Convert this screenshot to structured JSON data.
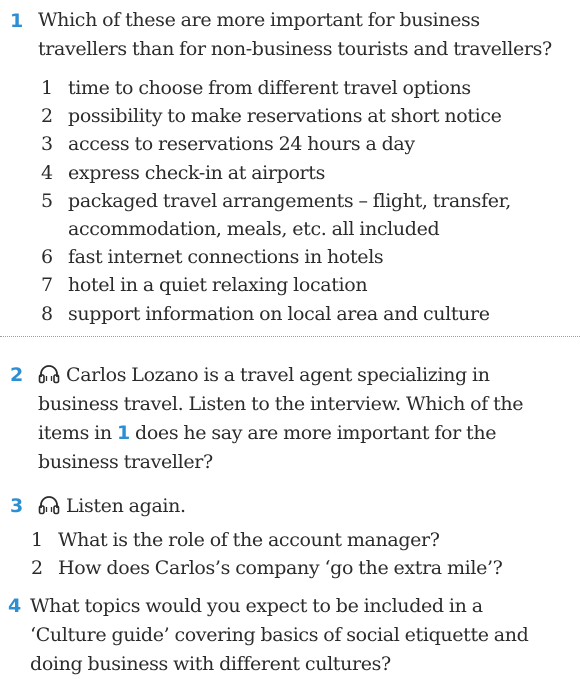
{
  "colors": {
    "accent": "#2c8fd4",
    "text": "#2b2b2b",
    "divider": "#9e9e9e"
  },
  "ex1": {
    "number": "1",
    "line1": "Which of these are more important for business",
    "line2": "travellers than for non-business tourists and travellers?",
    "items": [
      {
        "n": "1",
        "text": "time to choose from different travel options"
      },
      {
        "n": "2",
        "text": "possibility to make reservations at short notice"
      },
      {
        "n": "3",
        "text": "access to reservations 24 hours a day"
      },
      {
        "n": "4",
        "text": "express check-in at airports"
      },
      {
        "n": "5",
        "text": "packaged travel arrangements – flight, transfer,",
        "cont": "accommodation, meals, etc. all included"
      },
      {
        "n": "6",
        "text": "fast internet connections in hotels"
      },
      {
        "n": "7",
        "text": "hotel in a quiet relaxing location"
      },
      {
        "n": "8",
        "text": "support information on local area and culture"
      }
    ]
  },
  "ex2": {
    "number": "2",
    "icon": "headphones-icon",
    "line1": "Carlos Lozano is a travel agent specializing in",
    "line2": "business travel. Listen to the interview. Which of the",
    "line3a": "items in ",
    "line3ref": "1",
    "line3b": " does he say are more important for the",
    "line4": "business traveller?"
  },
  "ex3": {
    "number": "3",
    "icon": "headphones-icon",
    "line1": "Listen again.",
    "items": [
      {
        "n": "1",
        "text": "What is the role of the account manager?"
      },
      {
        "n": "2",
        "text": "How does Carlos’s company ‘go the extra mile’?"
      }
    ]
  },
  "ex4": {
    "number": "4",
    "line1": "What topics would you expect to be included in a",
    "line2": "‘Culture guide’ covering basics of social etiquette and",
    "line3": "doing business with different cultures?"
  }
}
